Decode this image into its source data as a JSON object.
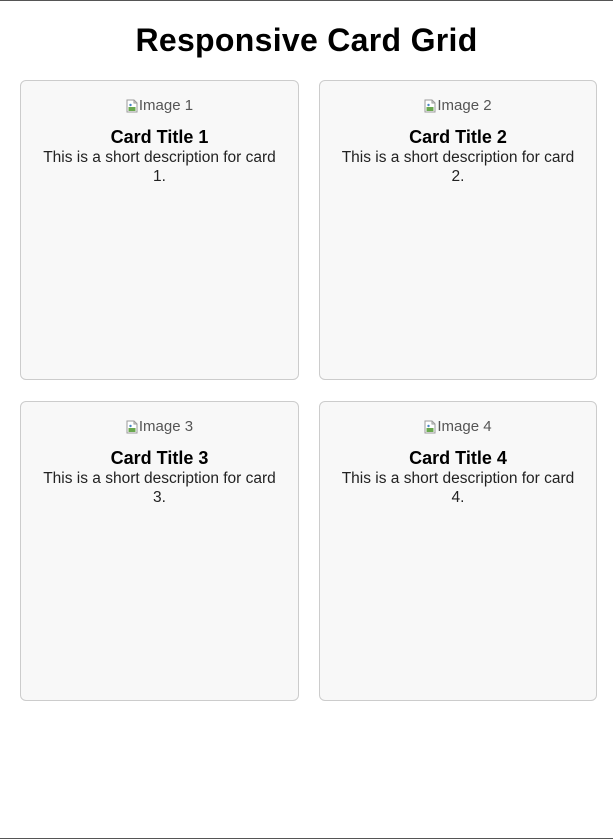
{
  "page": {
    "title": "Responsive Card Grid"
  },
  "cards": [
    {
      "image_alt": "Image 1",
      "title": "Card Title 1",
      "description": "This is a short description for card 1."
    },
    {
      "image_alt": "Image 2",
      "title": "Card Title 2",
      "description": "This is a short description for card 2."
    },
    {
      "image_alt": "Image 3",
      "title": "Card Title 3",
      "description": "This is a short description for card 3."
    },
    {
      "image_alt": "Image 4",
      "title": "Card Title 4",
      "description": "This is a short description for card 4."
    }
  ],
  "colors": {
    "card_background": "#f8f8f8",
    "card_border": "#cccccc",
    "text": "#000000"
  },
  "icons": {
    "broken_image": "broken-image-icon"
  }
}
